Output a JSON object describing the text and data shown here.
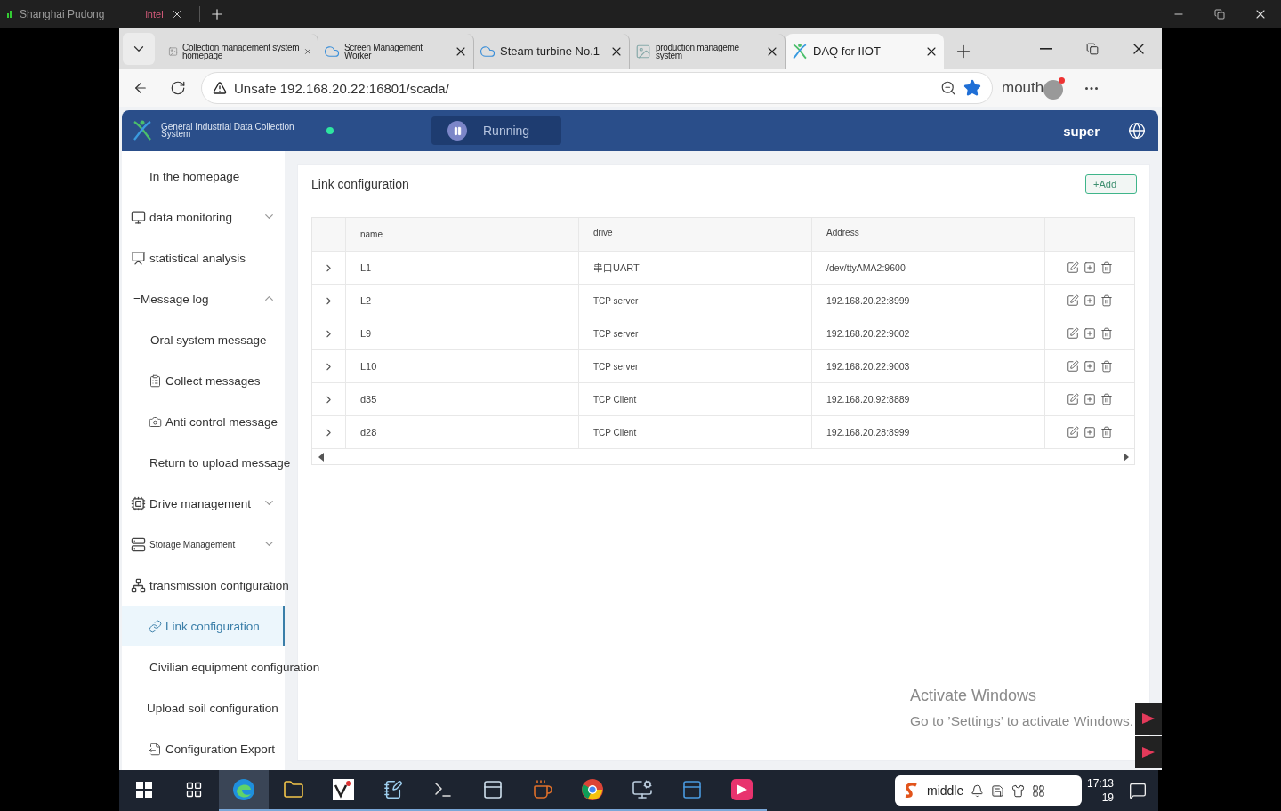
{
  "host_bar": {
    "tabs": [
      {
        "label": "Shanghai Pudong",
        "selected": false
      },
      {
        "label": "intel",
        "selected": true
      }
    ]
  },
  "browser": {
    "tabs": [
      {
        "title": [
          "Collection management system",
          "homepage"
        ],
        "selected": false
      },
      {
        "title": [
          "Screen Management",
          "Worker"
        ],
        "selected": false
      },
      {
        "title": [
          "Steam turbine No.1"
        ],
        "selected": false
      },
      {
        "title": [
          "production manageme",
          "system"
        ],
        "selected": false
      },
      {
        "title": [
          "DAQ for IIOT"
        ],
        "selected": true
      }
    ],
    "address": {
      "warning": "Unsafe",
      "url": "192.168.20.22:16801/scada/",
      "starred": true
    },
    "profile": {
      "name": "mouth",
      "notification": true
    }
  },
  "app": {
    "title": [
      "General Industrial Data Collection",
      "System"
    ],
    "status": {
      "label": "Running",
      "on": true
    },
    "user": "super"
  },
  "sidebar": {
    "items": [
      {
        "label": "In the homepage"
      },
      {
        "label": "data monitoring",
        "expanded": false
      },
      {
        "label": "statistical analysis"
      },
      {
        "label": "=Message log",
        "expanded": true,
        "children": [
          {
            "label": "Oral system message",
            "selected": false
          },
          {
            "label": "Collect messages",
            "selected": false
          },
          {
            "label": "Anti control message",
            "selected": false
          },
          {
            "label": "Return to upload message",
            "selected": false
          }
        ]
      },
      {
        "label": "Drive management",
        "expanded": false
      },
      {
        "label": "Storage Management",
        "expanded": false
      },
      {
        "label": "transmission configuration",
        "expanded": true,
        "children": [
          {
            "label": "Link configuration",
            "selected": true
          },
          {
            "label": "Civilian equipment configuration",
            "selected": false
          },
          {
            "label": "Upload soil configuration",
            "selected": false
          },
          {
            "label": "Configuration Export",
            "selected": false
          }
        ]
      }
    ]
  },
  "page": {
    "title": "Link configuration",
    "add_button": "+Add",
    "table": {
      "columns": [
        "name",
        "drive",
        "Address"
      ],
      "rows": [
        {
          "name": "L1",
          "drive": "串口UART",
          "address": "/dev/ttyAMA2:9600",
          "expanded": false
        },
        {
          "name": "L2",
          "drive": "TCP server",
          "address": "192.168.20.22:8999",
          "expanded": false
        },
        {
          "name": "L9",
          "drive": "TCP server",
          "address": "192.168.20.22:9002",
          "expanded": false
        },
        {
          "name": "L10",
          "drive": "TCP server",
          "address": "192.168.20.22:9003",
          "expanded": false
        },
        {
          "name": "d35",
          "drive": "TCP Client",
          "address": "192.168.20.92:8889",
          "expanded": false
        },
        {
          "name": "d28",
          "drive": "TCP Client",
          "address": "192.168.20.28:8999",
          "expanded": false
        }
      ]
    }
  },
  "activation": {
    "title": "Activate Windows",
    "text": "Go to ’Settings’ to activate Windows."
  },
  "taskbar": {
    "tray_label": "middle",
    "time": "17:13",
    "date": "19"
  }
}
